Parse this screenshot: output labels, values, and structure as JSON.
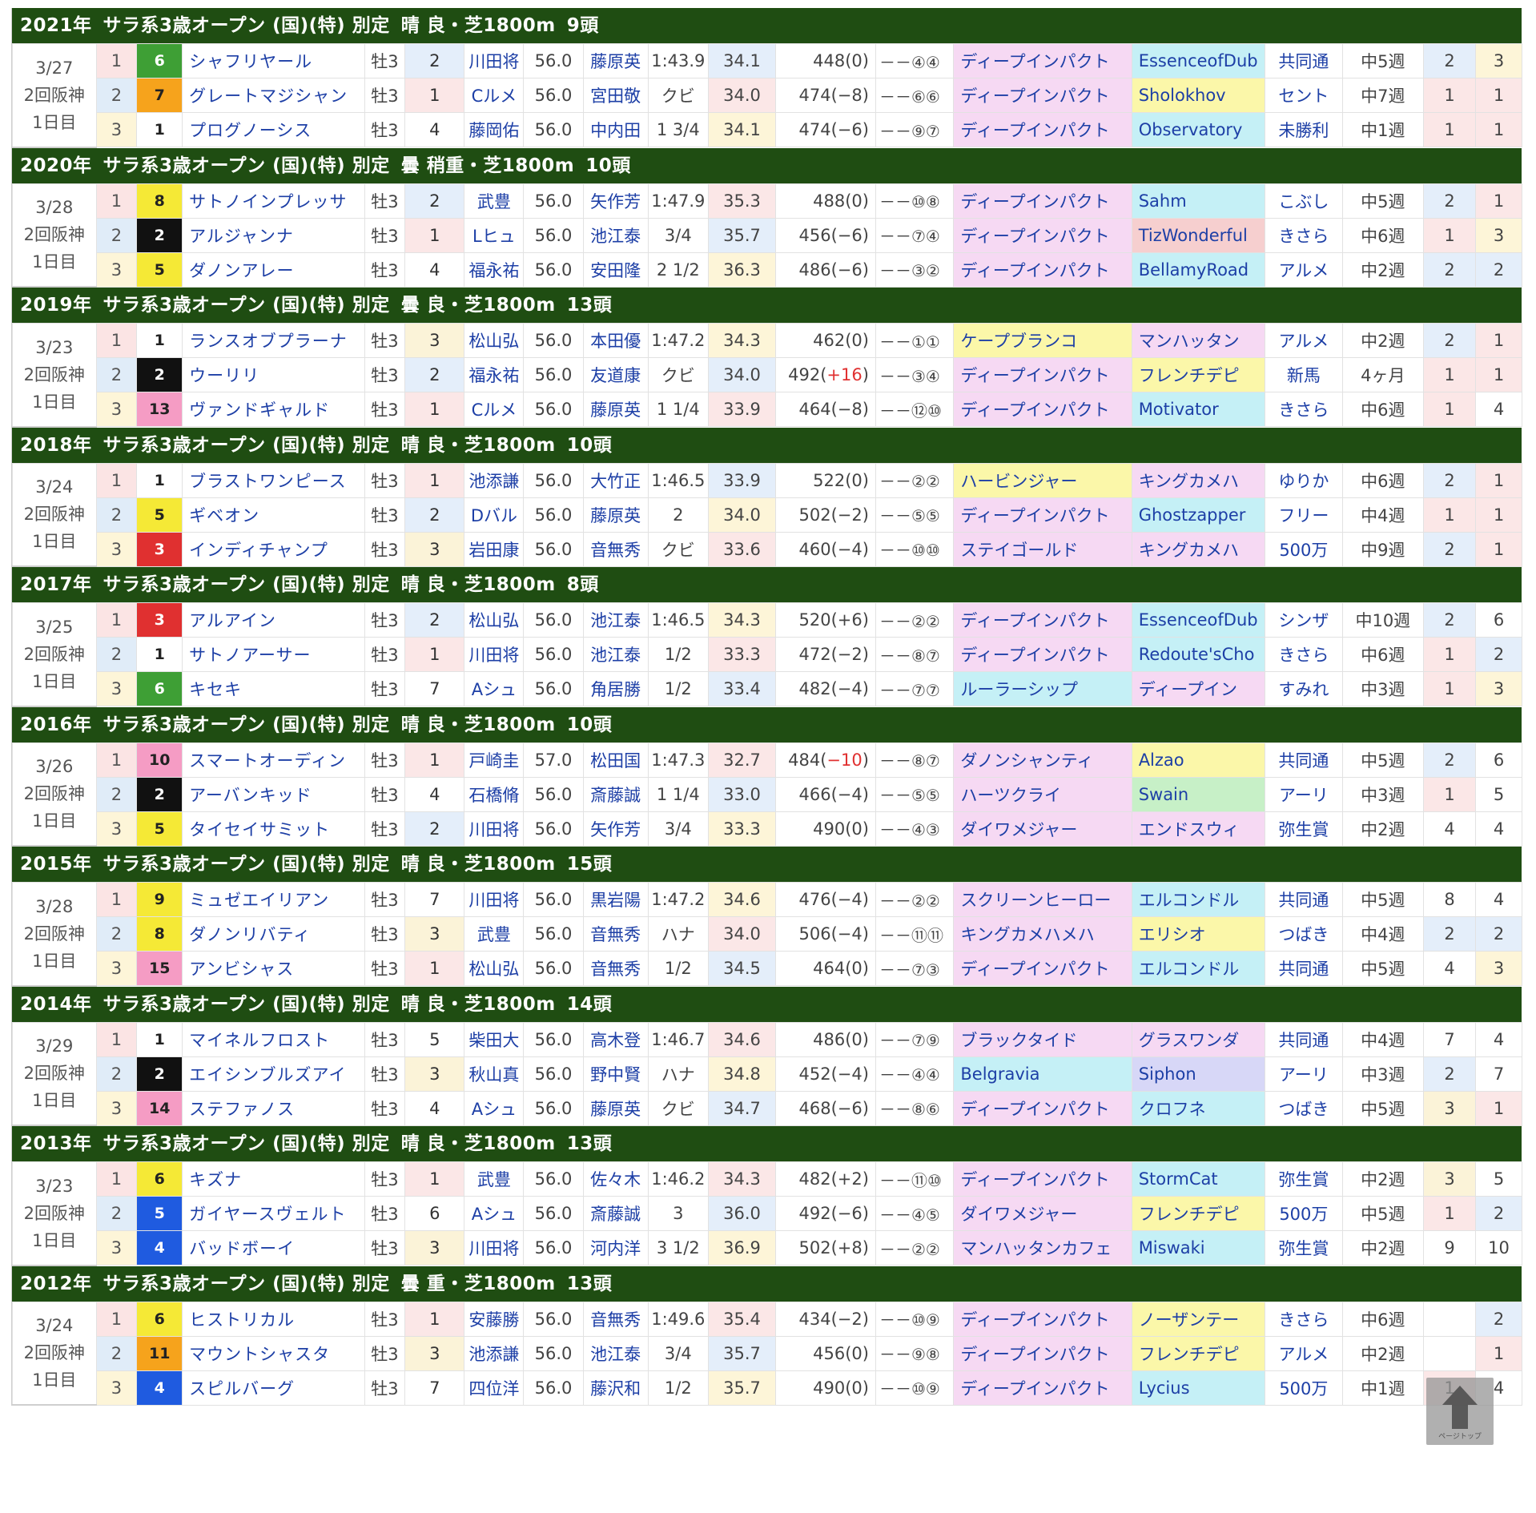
{
  "colors": {
    "header_bg": "#1f4d12",
    "waku": {
      "1": [
        "#ffffff",
        "#222"
      ],
      "2": [
        "#111111",
        "#fff"
      ],
      "3": [
        "#e03030",
        "#fff"
      ],
      "4": [
        "#1f5be0",
        "#fff"
      ],
      "5": [
        "#f5e936",
        "#222"
      ],
      "6": [
        "#3e9f35",
        "#fff"
      ],
      "7": [
        "#f6a31c",
        "#222"
      ],
      "8": [
        "#f59cc4",
        "#222"
      ]
    },
    "sire_bg": {
      "pink": "#f6d9f3",
      "yellow": "#fbf7a9",
      "cyan": "#c5f0f6",
      "green": "#c7f0c7",
      "lavender": "#d7d7f7",
      "salmon": "#f6cfcf"
    }
  },
  "races": [
    {
      "header": [
        "2021年",
        "サラ系3歳オープン (国)(特) 別定",
        "晴 良・芝1800m",
        "9頭"
      ],
      "date": [
        "3/27",
        "2回阪神",
        "1日目"
      ],
      "rows": [
        {
          "fin": "1",
          "waku": "6",
          "wk": "6",
          "name": "シャフリヤール",
          "sex": "牡3",
          "pop": "2",
          "jockey": "川田将",
          "wt": "56.0",
          "trainer": "藤原英",
          "time": "1:43.9",
          "f3": "34.1",
          "bw": "448(0)",
          "bwd": "",
          "cnr": "－－④④",
          "sire": "ディープインパクト",
          "sc": "pink",
          "bms": "EssenceofDub",
          "bc": "cyan",
          "prev": "共同通",
          "itv": "中5週",
          "n1": "2",
          "n2": "3"
        },
        {
          "fin": "2",
          "waku": "7",
          "wk": "7",
          "name": "グレートマジシャン",
          "sex": "牡3",
          "pop": "1",
          "jockey": "Cルメ",
          "wt": "56.0",
          "trainer": "宮田敬",
          "time": "クビ",
          "f3": "34.0",
          "bw": "474(−8)",
          "bwd": "",
          "cnr": "－－⑥⑥",
          "sire": "ディープインパクト",
          "sc": "pink",
          "bms": "Sholokhov",
          "bc": "yellow",
          "prev": "セント",
          "itv": "中7週",
          "n1": "1",
          "n2": "1"
        },
        {
          "fin": "3",
          "waku": "1",
          "wk": "1",
          "name": "プログノーシス",
          "sex": "牡3",
          "pop": "4",
          "jockey": "藤岡佑",
          "wt": "56.0",
          "trainer": "中内田",
          "time": "1 3/4",
          "f3": "34.1",
          "bw": "474(−6)",
          "bwd": "",
          "cnr": "－－⑨⑦",
          "sire": "ディープインパクト",
          "sc": "pink",
          "bms": "Observatory",
          "bc": "cyan",
          "prev": "未勝利",
          "itv": "中1週",
          "n1": "1",
          "n2": "1"
        }
      ]
    },
    {
      "header": [
        "2020年",
        "サラ系3歳オープン (国)(特) 別定",
        "曇 稍重・芝1800m",
        "10頭"
      ],
      "date": [
        "3/28",
        "2回阪神",
        "1日目"
      ],
      "rows": [
        {
          "fin": "1",
          "waku": "5",
          "wk": "8",
          "name": "サトノインプレッサ",
          "sex": "牡3",
          "pop": "2",
          "jockey": "武豊",
          "wt": "56.0",
          "trainer": "矢作芳",
          "time": "1:47.9",
          "f3": "35.3",
          "bw": "488(0)",
          "bwd": "",
          "cnr": "－－⑩⑧",
          "sire": "ディープインパクト",
          "sc": "pink",
          "bms": "Sahm",
          "bc": "cyan",
          "prev": "こぶし",
          "itv": "中5週",
          "n1": "2",
          "n2": "1"
        },
        {
          "fin": "2",
          "waku": "2",
          "wk": "2",
          "name": "アルジャンナ",
          "sex": "牡3",
          "pop": "1",
          "jockey": "Lヒュ",
          "wt": "56.0",
          "trainer": "池江泰",
          "time": "3/4",
          "f3": "35.7",
          "bw": "456(−6)",
          "bwd": "",
          "cnr": "－－⑦④",
          "sire": "ディープインパクト",
          "sc": "pink",
          "bms": "TizWonderful",
          "bc": "salmon",
          "prev": "きさら",
          "itv": "中6週",
          "n1": "1",
          "n2": "3"
        },
        {
          "fin": "3",
          "waku": "5",
          "wk": "5",
          "name": "ダノンアレー",
          "sex": "牡3",
          "pop": "4",
          "jockey": "福永祐",
          "wt": "56.0",
          "trainer": "安田隆",
          "time": "2 1/2",
          "f3": "36.3",
          "bw": "486(−6)",
          "bwd": "",
          "cnr": "－－③②",
          "sire": "ディープインパクト",
          "sc": "pink",
          "bms": "BellamyRoad",
          "bc": "cyan",
          "prev": "アルメ",
          "itv": "中2週",
          "n1": "2",
          "n2": "2"
        }
      ]
    },
    {
      "header": [
        "2019年",
        "サラ系3歳オープン (国)(特) 別定",
        "曇 良・芝1800m",
        "13頭"
      ],
      "date": [
        "3/23",
        "2回阪神",
        "1日目"
      ],
      "rows": [
        {
          "fin": "1",
          "waku": "1",
          "wk": "1",
          "name": "ランスオブプラーナ",
          "sex": "牡3",
          "pop": "3",
          "jockey": "松山弘",
          "wt": "56.0",
          "trainer": "本田優",
          "time": "1:47.2",
          "f3": "34.3",
          "bw": "462(0)",
          "bwd": "",
          "cnr": "－－①①",
          "sire": "ケープブランコ",
          "sc": "yellow",
          "bms": "マンハッタン",
          "bc": "pink",
          "prev": "アルメ",
          "itv": "中2週",
          "n1": "2",
          "n2": "1"
        },
        {
          "fin": "2",
          "waku": "2",
          "wk": "2",
          "name": "ウーリリ",
          "sex": "牡3",
          "pop": "2",
          "jockey": "福永祐",
          "wt": "56.0",
          "trainer": "友道康",
          "time": "クビ",
          "f3": "34.0",
          "bw": "492(",
          "bwd": "+16",
          "cnr": "－－③④",
          "sire": "ディープインパクト",
          "sc": "pink",
          "bms": "フレンチデピ",
          "bc": "yellow",
          "prev": "新馬",
          "itv": "4ヶ月",
          "n1": "1",
          "n2": "1"
        },
        {
          "fin": "3",
          "waku": "8",
          "wk": "13",
          "name": "ヴァンドギャルド",
          "sex": "牡3",
          "pop": "1",
          "jockey": "Cルメ",
          "wt": "56.0",
          "trainer": "藤原英",
          "time": "1 1/4",
          "f3": "33.9",
          "bw": "464(−8)",
          "bwd": "",
          "cnr": "－－⑫⑩",
          "sire": "ディープインパクト",
          "sc": "pink",
          "bms": "Motivator",
          "bc": "cyan",
          "prev": "きさら",
          "itv": "中6週",
          "n1": "1",
          "n2": "4"
        }
      ]
    },
    {
      "header": [
        "2018年",
        "サラ系3歳オープン (国)(特) 別定",
        "晴 良・芝1800m",
        "10頭"
      ],
      "date": [
        "3/24",
        "2回阪神",
        "1日目"
      ],
      "rows": [
        {
          "fin": "1",
          "waku": "1",
          "wk": "1",
          "name": "ブラストワンピース",
          "sex": "牡3",
          "pop": "1",
          "jockey": "池添謙",
          "wt": "56.0",
          "trainer": "大竹正",
          "time": "1:46.5",
          "f3": "33.9",
          "bw": "522(0)",
          "bwd": "",
          "cnr": "－－②②",
          "sire": "ハービンジャー",
          "sc": "yellow",
          "bms": "キングカメハ",
          "bc": "pink",
          "prev": "ゆりか",
          "itv": "中6週",
          "n1": "2",
          "n2": "1"
        },
        {
          "fin": "2",
          "waku": "5",
          "wk": "5",
          "name": "ギベオン",
          "sex": "牡3",
          "pop": "2",
          "jockey": "Dバル",
          "wt": "56.0",
          "trainer": "藤原英",
          "time": "2",
          "f3": "34.0",
          "bw": "502(−2)",
          "bwd": "",
          "cnr": "－－⑤⑤",
          "sire": "ディープインパクト",
          "sc": "pink",
          "bms": "Ghostzapper",
          "bc": "cyan",
          "prev": "フリー",
          "itv": "中4週",
          "n1": "1",
          "n2": "1"
        },
        {
          "fin": "3",
          "waku": "3",
          "wk": "3",
          "name": "インディチャンプ",
          "sex": "牡3",
          "pop": "3",
          "jockey": "岩田康",
          "wt": "56.0",
          "trainer": "音無秀",
          "time": "クビ",
          "f3": "33.6",
          "bw": "460(−4)",
          "bwd": "",
          "cnr": "－－⑩⑩",
          "sire": "ステイゴールド",
          "sc": "pink",
          "bms": "キングカメハ",
          "bc": "pink",
          "prev": "500万",
          "itv": "中9週",
          "n1": "2",
          "n2": "1"
        }
      ]
    },
    {
      "header": [
        "2017年",
        "サラ系3歳オープン (国)(特) 別定",
        "晴 良・芝1800m",
        "8頭"
      ],
      "date": [
        "3/25",
        "2回阪神",
        "1日目"
      ],
      "rows": [
        {
          "fin": "1",
          "waku": "3",
          "wk": "3",
          "name": "アルアイン",
          "sex": "牡3",
          "pop": "2",
          "jockey": "松山弘",
          "wt": "56.0",
          "trainer": "池江泰",
          "time": "1:46.5",
          "f3": "34.3",
          "bw": "520(+6)",
          "bwd": "",
          "cnr": "－－②②",
          "sire": "ディープインパクト",
          "sc": "pink",
          "bms": "EssenceofDub",
          "bc": "cyan",
          "prev": "シンザ",
          "itv": "中10週",
          "n1": "2",
          "n2": "6"
        },
        {
          "fin": "2",
          "waku": "1",
          "wk": "1",
          "name": "サトノアーサー",
          "sex": "牡3",
          "pop": "1",
          "jockey": "川田将",
          "wt": "56.0",
          "trainer": "池江泰",
          "time": "1/2",
          "f3": "33.3",
          "bw": "472(−2)",
          "bwd": "",
          "cnr": "－－⑧⑦",
          "sire": "ディープインパクト",
          "sc": "pink",
          "bms": "Redoute'sCho",
          "bc": "cyan",
          "prev": "きさら",
          "itv": "中6週",
          "n1": "1",
          "n2": "2"
        },
        {
          "fin": "3",
          "waku": "6",
          "wk": "6",
          "name": "キセキ",
          "sex": "牡3",
          "pop": "7",
          "jockey": "Aシュ",
          "wt": "56.0",
          "trainer": "角居勝",
          "time": "1/2",
          "f3": "33.4",
          "bw": "482(−4)",
          "bwd": "",
          "cnr": "－－⑦⑦",
          "sire": "ルーラーシップ",
          "sc": "cyan",
          "bms": "ディープイン",
          "bc": "pink",
          "prev": "すみれ",
          "itv": "中3週",
          "n1": "1",
          "n2": "3"
        }
      ]
    },
    {
      "header": [
        "2016年",
        "サラ系3歳オープン (国)(特) 別定",
        "晴 良・芝1800m",
        "10頭"
      ],
      "date": [
        "3/26",
        "2回阪神",
        "1日目"
      ],
      "rows": [
        {
          "fin": "1",
          "waku": "8",
          "wk": "10",
          "name": "スマートオーディン",
          "sex": "牡3",
          "pop": "1",
          "jockey": "戸崎圭",
          "wt": "57.0",
          "trainer": "松田国",
          "time": "1:47.3",
          "f3": "32.7",
          "bw": "484(",
          "bwd": "−10",
          "cnr": "－－⑧⑦",
          "sire": "ダノンシャンティ",
          "sc": "pink",
          "bms": "Alzao",
          "bc": "yellow",
          "prev": "共同通",
          "itv": "中5週",
          "n1": "2",
          "n2": "6"
        },
        {
          "fin": "2",
          "waku": "2",
          "wk": "2",
          "name": "アーバンキッド",
          "sex": "牡3",
          "pop": "4",
          "jockey": "石橋脩",
          "wt": "56.0",
          "trainer": "斎藤誠",
          "time": "1 1/4",
          "f3": "33.0",
          "bw": "466(−4)",
          "bwd": "",
          "cnr": "－－⑤⑤",
          "sire": "ハーツクライ",
          "sc": "pink",
          "bms": "Swain",
          "bc": "green",
          "prev": "アーリ",
          "itv": "中3週",
          "n1": "1",
          "n2": "5"
        },
        {
          "fin": "3",
          "waku": "5",
          "wk": "5",
          "name": "タイセイサミット",
          "sex": "牡3",
          "pop": "2",
          "jockey": "川田将",
          "wt": "56.0",
          "trainer": "矢作芳",
          "time": "3/4",
          "f3": "33.3",
          "bw": "490(0)",
          "bwd": "",
          "cnr": "－－④③",
          "sire": "ダイワメジャー",
          "sc": "pink",
          "bms": "エンドスウィ",
          "bc": "pink",
          "prev": "弥生賞",
          "itv": "中2週",
          "n1": "4",
          "n2": "4"
        }
      ]
    },
    {
      "header": [
        "2015年",
        "サラ系3歳オープン (国)(特) 別定",
        "晴 良・芝1800m",
        "15頭"
      ],
      "date": [
        "3/28",
        "2回阪神",
        "1日目"
      ],
      "rows": [
        {
          "fin": "1",
          "waku": "5",
          "wk": "9",
          "name": "ミュゼエイリアン",
          "sex": "牡3",
          "pop": "7",
          "jockey": "川田将",
          "wt": "56.0",
          "trainer": "黒岩陽",
          "time": "1:47.2",
          "f3": "34.6",
          "bw": "476(−4)",
          "bwd": "",
          "cnr": "－－②②",
          "sire": "スクリーンヒーロー",
          "sc": "pink",
          "bms": "エルコンドル",
          "bc": "cyan",
          "prev": "共同通",
          "itv": "中5週",
          "n1": "8",
          "n2": "4"
        },
        {
          "fin": "2",
          "waku": "5",
          "wk": "8",
          "name": "ダノンリバティ",
          "sex": "牡3",
          "pop": "3",
          "jockey": "武豊",
          "wt": "56.0",
          "trainer": "音無秀",
          "time": "ハナ",
          "f3": "34.0",
          "bw": "506(−4)",
          "bwd": "",
          "cnr": "－－⑪⑪",
          "sire": "キングカメハメハ",
          "sc": "pink",
          "bms": "エリシオ",
          "bc": "yellow",
          "prev": "つばき",
          "itv": "中4週",
          "n1": "2",
          "n2": "2"
        },
        {
          "fin": "3",
          "waku": "8",
          "wk": "15",
          "name": "アンビシャス",
          "sex": "牡3",
          "pop": "1",
          "jockey": "松山弘",
          "wt": "56.0",
          "trainer": "音無秀",
          "time": "1/2",
          "f3": "34.5",
          "bw": "464(0)",
          "bwd": "",
          "cnr": "－－⑦③",
          "sire": "ディープインパクト",
          "sc": "pink",
          "bms": "エルコンドル",
          "bc": "cyan",
          "prev": "共同通",
          "itv": "中5週",
          "n1": "4",
          "n2": "3"
        }
      ]
    },
    {
      "header": [
        "2014年",
        "サラ系3歳オープン (国)(特) 別定",
        "晴 良・芝1800m",
        "14頭"
      ],
      "date": [
        "3/29",
        "2回阪神",
        "1日目"
      ],
      "rows": [
        {
          "fin": "1",
          "waku": "1",
          "wk": "1",
          "name": "マイネルフロスト",
          "sex": "牡3",
          "pop": "5",
          "jockey": "柴田大",
          "wt": "56.0",
          "trainer": "高木登",
          "time": "1:46.7",
          "f3": "34.6",
          "bw": "486(0)",
          "bwd": "",
          "cnr": "－－⑦⑨",
          "sire": "ブラックタイド",
          "sc": "pink",
          "bms": "グラスワンダ",
          "bc": "pink",
          "prev": "共同通",
          "itv": "中4週",
          "n1": "7",
          "n2": "4"
        },
        {
          "fin": "2",
          "waku": "2",
          "wk": "2",
          "name": "エイシンブルズアイ",
          "sex": "牡3",
          "pop": "3",
          "jockey": "秋山真",
          "wt": "56.0",
          "trainer": "野中賢",
          "time": "ハナ",
          "f3": "34.8",
          "bw": "452(−4)",
          "bwd": "",
          "cnr": "－－④④",
          "sire": "Belgravia",
          "sc": "cyan",
          "bms": "Siphon",
          "bc": "lavender",
          "prev": "アーリ",
          "itv": "中3週",
          "n1": "2",
          "n2": "7"
        },
        {
          "fin": "3",
          "waku": "8",
          "wk": "14",
          "name": "ステファノス",
          "sex": "牡3",
          "pop": "4",
          "jockey": "Aシュ",
          "wt": "56.0",
          "trainer": "藤原英",
          "time": "クビ",
          "f3": "34.7",
          "bw": "468(−6)",
          "bwd": "",
          "cnr": "－－⑧⑥",
          "sire": "ディープインパクト",
          "sc": "pink",
          "bms": "クロフネ",
          "bc": "cyan",
          "prev": "つばき",
          "itv": "中5週",
          "n1": "3",
          "n2": "1"
        }
      ]
    },
    {
      "header": [
        "2013年",
        "サラ系3歳オープン (国)(特) 別定",
        "晴 良・芝1800m",
        "13頭"
      ],
      "date": [
        "3/23",
        "2回阪神",
        "1日目"
      ],
      "rows": [
        {
          "fin": "1",
          "waku": "5",
          "wk": "6",
          "name": "キズナ",
          "sex": "牡3",
          "pop": "1",
          "jockey": "武豊",
          "wt": "56.0",
          "trainer": "佐々木",
          "time": "1:46.2",
          "f3": "34.3",
          "bw": "482(+2)",
          "bwd": "",
          "cnr": "－－⑪⑩",
          "sire": "ディープインパクト",
          "sc": "pink",
          "bms": "StormCat",
          "bc": "cyan",
          "prev": "弥生賞",
          "itv": "中2週",
          "n1": "3",
          "n2": "5"
        },
        {
          "fin": "2",
          "waku": "4",
          "wk": "5",
          "name": "ガイヤースヴェルト",
          "sex": "牡3",
          "pop": "6",
          "jockey": "Aシュ",
          "wt": "56.0",
          "trainer": "斎藤誠",
          "time": "3",
          "f3": "36.0",
          "bw": "492(−6)",
          "bwd": "",
          "cnr": "－－④⑤",
          "sire": "ダイワメジャー",
          "sc": "pink",
          "bms": "フレンチデピ",
          "bc": "yellow",
          "prev": "500万",
          "itv": "中5週",
          "n1": "1",
          "n2": "2"
        },
        {
          "fin": "3",
          "waku": "4",
          "wk": "4",
          "name": "バッドボーイ",
          "sex": "牡3",
          "pop": "3",
          "jockey": "川田将",
          "wt": "56.0",
          "trainer": "河内洋",
          "time": "3 1/2",
          "f3": "36.9",
          "bw": "502(+8)",
          "bwd": "",
          "cnr": "－－②②",
          "sire": "マンハッタンカフェ",
          "sc": "pink",
          "bms": "Miswaki",
          "bc": "cyan",
          "prev": "弥生賞",
          "itv": "中2週",
          "n1": "9",
          "n2": "10"
        }
      ]
    },
    {
      "header": [
        "2012年",
        "サラ系3歳オープン (国)(特) 別定",
        "曇 重・芝1800m",
        "13頭"
      ],
      "date": [
        "3/24",
        "2回阪神",
        "1日目"
      ],
      "rows": [
        {
          "fin": "1",
          "waku": "5",
          "wk": "6",
          "name": "ヒストリカル",
          "sex": "牡3",
          "pop": "1",
          "jockey": "安藤勝",
          "wt": "56.0",
          "trainer": "音無秀",
          "time": "1:49.6",
          "f3": "35.4",
          "bw": "434(−2)",
          "bwd": "",
          "cnr": "－－⑩⑨",
          "sire": "ディープインパクト",
          "sc": "pink",
          "bms": "ノーザンテー",
          "bc": "yellow",
          "prev": "きさら",
          "itv": "中6週",
          "n1": "",
          "n2": "2"
        },
        {
          "fin": "2",
          "waku": "7",
          "wk": "11",
          "name": "マウントシャスタ",
          "sex": "牡3",
          "pop": "3",
          "jockey": "池添謙",
          "wt": "56.0",
          "trainer": "池江泰",
          "time": "3/4",
          "f3": "35.7",
          "bw": "456(0)",
          "bwd": "",
          "cnr": "－－⑨⑧",
          "sire": "ディープインパクト",
          "sc": "pink",
          "bms": "フレンチデピ",
          "bc": "yellow",
          "prev": "アルメ",
          "itv": "中2週",
          "n1": "",
          "n2": "1"
        },
        {
          "fin": "3",
          "waku": "4",
          "wk": "4",
          "name": "スピルバーグ",
          "sex": "牡3",
          "pop": "7",
          "jockey": "四位洋",
          "wt": "56.0",
          "trainer": "藤沢和",
          "time": "1/2",
          "f3": "35.7",
          "bw": "490(0)",
          "bwd": "",
          "cnr": "－－⑩⑨",
          "sire": "ディープインパクト",
          "sc": "pink",
          "bms": "Lycius",
          "bc": "cyan",
          "prev": "500万",
          "itv": "中1週",
          "n1": "1",
          "n2": "4"
        }
      ]
    }
  ],
  "gotop": {
    "icon": "arrow-up-icon",
    "label": "ページトップ"
  }
}
